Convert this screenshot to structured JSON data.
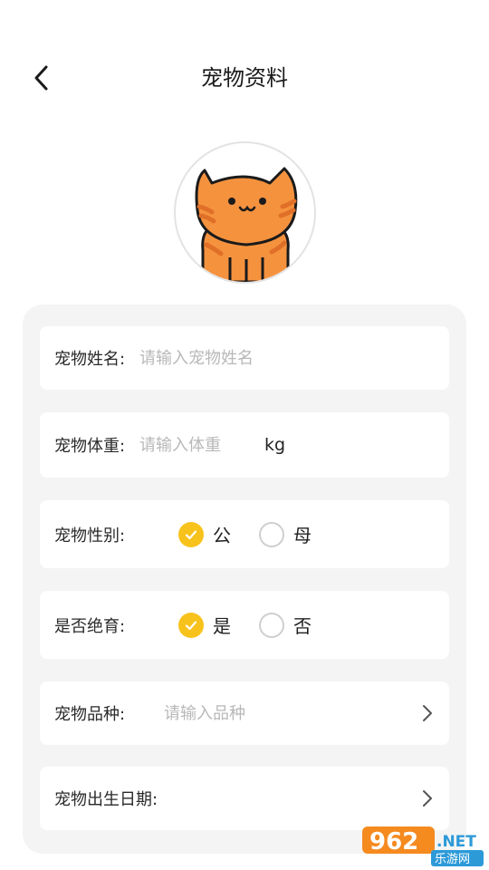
{
  "header": {
    "title": "宠物资料",
    "back_icon": "chevron-left-icon"
  },
  "avatar": {
    "icon": "orange-cat-avatar"
  },
  "form": {
    "name": {
      "label": "宠物姓名:",
      "placeholder": "请输入宠物姓名",
      "value": ""
    },
    "weight": {
      "label": "宠物体重:",
      "placeholder": "请输入体重",
      "value": "",
      "unit": "kg"
    },
    "gender": {
      "label": "宠物性别:",
      "options": [
        {
          "label": "公",
          "checked": true
        },
        {
          "label": "母",
          "checked": false
        }
      ]
    },
    "neutered": {
      "label": "是否绝育:",
      "options": [
        {
          "label": "是",
          "checked": true
        },
        {
          "label": "否",
          "checked": false
        }
      ]
    },
    "breed": {
      "label": "宠物品种:",
      "placeholder": "请输入品种",
      "value": ""
    },
    "birthday": {
      "label": "宠物出生日期:",
      "value": ""
    }
  },
  "watermark": {
    "number": "962",
    "suffix": ".NET",
    "sub": "乐游网"
  },
  "colors": {
    "accent": "#f8c21c",
    "card_bg": "#f4f4f4",
    "placeholder": "#b8b8b8",
    "cat_orange": "#f5923e"
  }
}
